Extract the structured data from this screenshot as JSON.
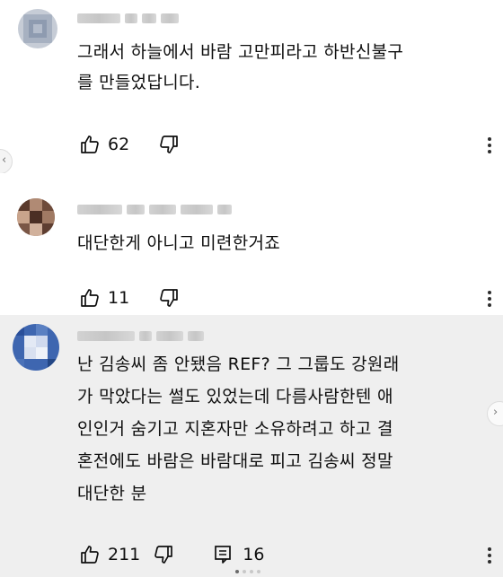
{
  "comments": [
    {
      "text": "그래서 하늘에서 바람 고만피라고  하반신불구\n를 만들었답니다.",
      "likes": "62",
      "avatar_color": "#9aa7b8"
    },
    {
      "text": "대단한게 아니고 미련한거죠",
      "likes": "11",
      "avatar_color": "#6b4a3a"
    },
    {
      "text": "난 김송씨  좀  안됐음 REF? 그 그룹도 강원래\n가 막았다는 썰도  있었는데  다름사람한텐 애\n인인거 숨기고  지혼자만  소유하려고 하고 결\n혼전에도  바람은  바람대로 피고  김송씨 정말\n대단한 분",
      "likes": "211",
      "replies": "16",
      "avatar_color": "#2f5aa6"
    }
  ],
  "icons": [
    "thumbs-up-icon",
    "thumbs-down-icon",
    "reply-icon",
    "more-vert-icon",
    "chevron-left-icon",
    "chevron-right-icon"
  ]
}
